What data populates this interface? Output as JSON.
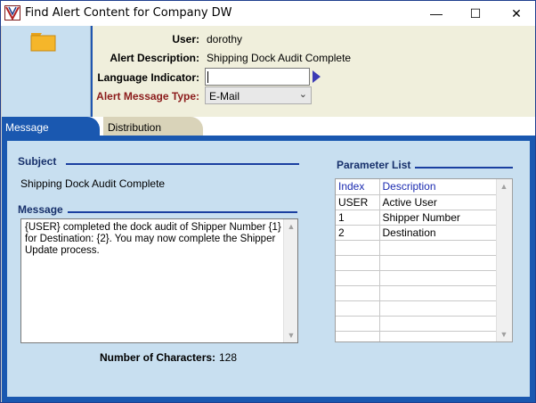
{
  "window": {
    "title": "Find Alert Content for Company DW",
    "minimize_glyph": "—",
    "maximize_glyph": "☐",
    "close_glyph": "✕"
  },
  "header": {
    "user_label": "User:",
    "user_value": "dorothy",
    "alert_desc_label": "Alert Description:",
    "alert_desc_value": "Shipping Dock Audit Complete",
    "language_label": "Language Indicator:",
    "language_value": "",
    "message_type_label": "Alert Message Type:",
    "message_type_value": "E-Mail"
  },
  "tabs": [
    {
      "label": "Message",
      "active": true
    },
    {
      "label": "Distribution",
      "active": false
    }
  ],
  "message_tab": {
    "subject_title": "Subject",
    "subject_value": "Shipping Dock Audit Complete",
    "message_title": "Message",
    "message_text": "{USER} completed the dock audit of Shipper Number  {1} for Destination:  {2}.  You may now complete the Shipper Update process.",
    "num_chars_label": "Number of Characters:",
    "num_chars_value": "128"
  },
  "parameter_list": {
    "title": "Parameter List",
    "columns": [
      "Index",
      "Description"
    ],
    "rows": [
      [
        "USER",
        "Active User"
      ],
      [
        "1",
        "Shipper Number"
      ],
      [
        "2",
        "Destination"
      ]
    ]
  },
  "icons": {
    "app": "alert-app-icon",
    "folder": "folder-icon",
    "lookup_arrow": "play-arrow-icon",
    "dropdown": "chevron-down-icon"
  },
  "colors": {
    "accent_blue": "#1a58b0",
    "panel_blue": "#c8dff0",
    "header_cream": "#f0efdc",
    "required_label_red": "#8b1b1b",
    "section_title_navy": "#17306b"
  }
}
